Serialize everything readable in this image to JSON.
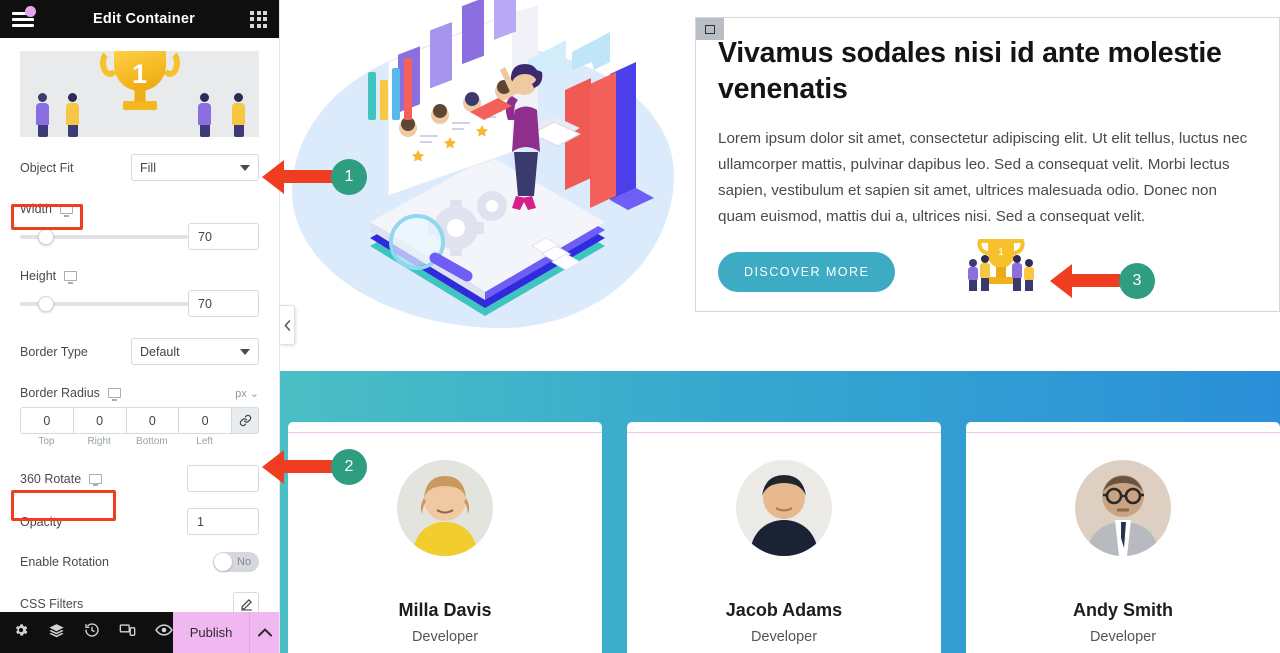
{
  "panel": {
    "title": "Edit Container",
    "menu_icon": "hamburger-icon",
    "grid_icon": "grid-icon",
    "thumbnail_number": "1",
    "controls": [
      {
        "label": "Object Fit",
        "type": "select",
        "value": "Fill"
      },
      {
        "label": "Width",
        "type": "slider",
        "value": "70"
      },
      {
        "label": "Height",
        "type": "slider",
        "value": "70"
      },
      {
        "label": "Border Type",
        "type": "select",
        "value": "Default"
      },
      {
        "label": "Border Radius",
        "type": "radius",
        "unit": "px"
      },
      {
        "label": "360 Rotate",
        "type": "input",
        "value": ""
      },
      {
        "label": "Opacity",
        "type": "input",
        "value": "1"
      },
      {
        "label": "Enable Rotation",
        "type": "toggle",
        "value": "No"
      },
      {
        "label": "CSS Filters",
        "type": "edit"
      }
    ],
    "radius": {
      "top": "0",
      "right": "0",
      "bottom": "0",
      "left": "0",
      "labels": {
        "top": "Top",
        "right": "Right",
        "bottom": "Bottom",
        "left": "Left"
      },
      "unit": "px"
    },
    "footer": {
      "icons": [
        "settings-icon",
        "layers-icon",
        "history-icon",
        "responsive-icon",
        "preview-icon"
      ],
      "publish_label": "Publish",
      "chevron": "chevron-up-icon"
    },
    "collapse_icon": "chevron-left-icon"
  },
  "hero": {
    "title": "Vivamus sodales nisi id ante molestie venenatis",
    "body": "Lorem ipsum dolor sit amet, consectetur adipiscing elit. Ut elit tellus, luctus nec ullamcorper mattis, pulvinar dapibus leo. Sed a consequat velit. Morbi lectus sapien, vestibulum et sapien sit amet, ultrices malesuada odio. Donec non quam euismod, mattis dui a, ultrices nisi. Sed a consequat velit.",
    "button_label": "DISCOVER MORE",
    "button_color": "#3eabc4",
    "illustration": "isometric-workspace-illustration",
    "trophy": "trophy-icon"
  },
  "team": {
    "band_gradient_start": "#4bbfc4",
    "band_gradient_end": "#2b8fd8",
    "members": [
      {
        "name": "Milla Davis",
        "role": "Developer"
      },
      {
        "name": "Jacob Adams",
        "role": "Developer"
      },
      {
        "name": "Andy Smith",
        "role": "Developer"
      }
    ]
  },
  "annotations": {
    "marker_color": "#2f9e80",
    "arrow_color": "#ef3d22",
    "items": [
      {
        "number": "1",
        "target": "object-fit-control"
      },
      {
        "number": "2",
        "target": "360-rotate-control"
      },
      {
        "number": "3",
        "target": "hero-trophy-image"
      }
    ]
  }
}
